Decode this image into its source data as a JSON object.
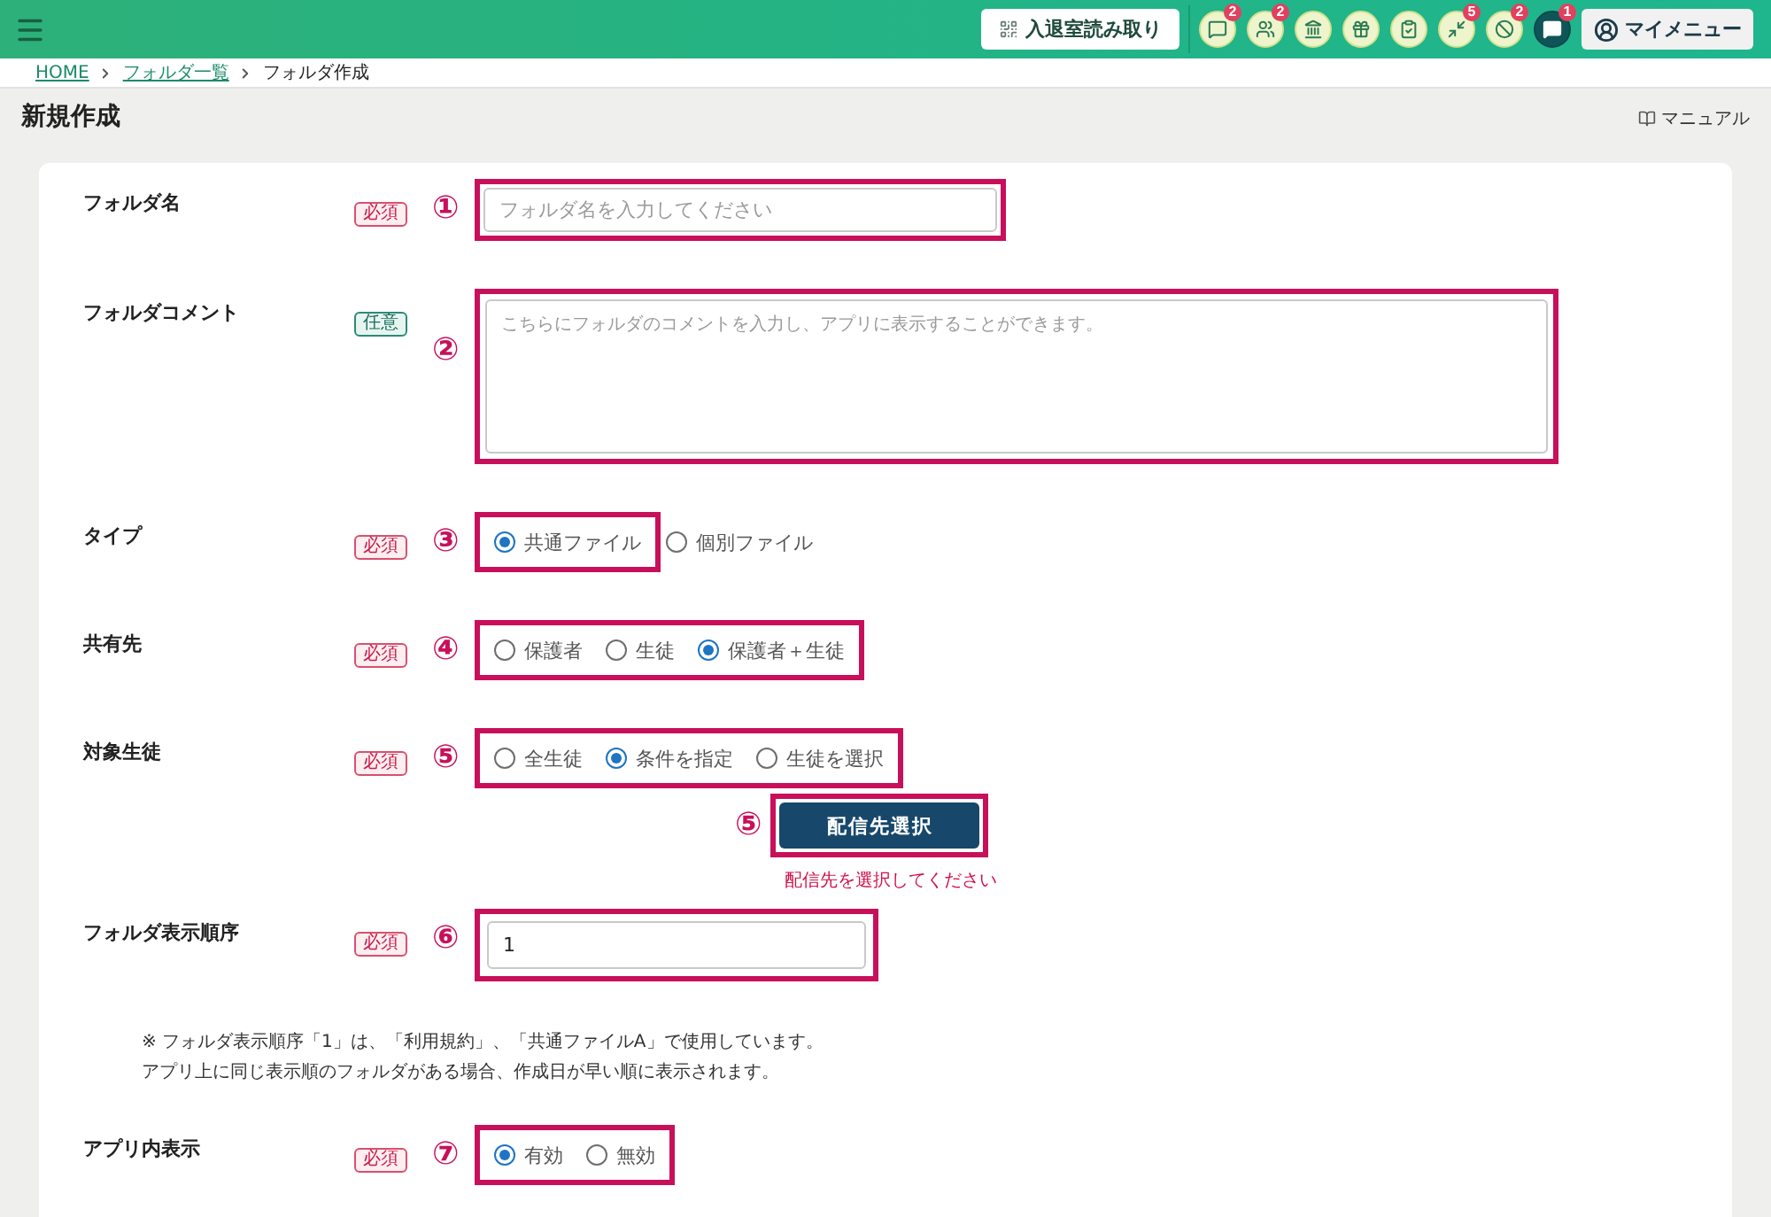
{
  "header": {
    "scan_button": "入退室読み取り",
    "icon_buttons": [
      {
        "badge": "2",
        "selected": false
      },
      {
        "badge": "2",
        "selected": false
      },
      {
        "selected": false
      },
      {
        "selected": false
      },
      {
        "selected": false
      },
      {
        "badge": "5",
        "selected": false
      },
      {
        "badge": "2",
        "selected": false
      },
      {
        "badge": "1",
        "selected": true
      }
    ],
    "menu_button": "マイメニュー"
  },
  "breadcrumb": [
    {
      "label": "HOME",
      "link": true
    },
    {
      "label": "フォルダ一覧",
      "link": true
    },
    {
      "label": "フォルダ作成",
      "link": false
    }
  ],
  "page": {
    "title": "新規作成",
    "manual_link": "マニュアル"
  },
  "form": {
    "fields": [
      {
        "kind": "text",
        "label": "フォルダ名",
        "badge": {
          "label": "必須",
          "required": true
        },
        "marker": "①",
        "placeholder": "フォルダ名を入力してください"
      },
      {
        "kind": "textarea",
        "label": "フォルダコメント",
        "badge": {
          "label": "任意",
          "required": false
        },
        "marker": "②",
        "placeholder": "こちらにフォルダのコメントを入力し、アプリに表示することができます。"
      },
      {
        "kind": "radio",
        "label": "タイプ",
        "badge": {
          "label": "必須",
          "required": true
        },
        "marker": "③",
        "options": [
          {
            "label": "共通ファイル",
            "selected": true
          }
        ],
        "options_outside_frame": [
          {
            "label": "個別ファイル",
            "selected": false
          }
        ]
      },
      {
        "kind": "radio",
        "label": "共有先",
        "badge": {
          "label": "必須",
          "required": true
        },
        "marker": "④",
        "options": [
          {
            "label": "保護者",
            "selected": false
          },
          {
            "label": "生徒",
            "selected": false
          },
          {
            "label": "保護者＋生徒",
            "selected": true
          }
        ]
      },
      {
        "kind": "radio",
        "label": "対象生徒",
        "badge": {
          "label": "必須",
          "required": true
        },
        "marker": "⑤",
        "options": [
          {
            "label": "全生徒",
            "selected": false
          },
          {
            "label": "条件を指定",
            "selected": true
          },
          {
            "label": "生徒を選択",
            "selected": false
          }
        ],
        "action": {
          "marker": "⑤",
          "button": "配信先選択",
          "error": "配信先を選択してください"
        }
      },
      {
        "kind": "number",
        "label": "フォルダ表示順序",
        "badge": {
          "label": "必須",
          "required": true
        },
        "marker": "⑥",
        "value": "1",
        "notes": [
          "※ フォルダ表示順序「1」は、「利用規約」、「共通ファイルA」で使用しています。",
          "アプリ上に同じ表示順のフォルダがある場合、作成日が早い順に表示されます。"
        ]
      },
      {
        "kind": "radio",
        "label": "アプリ内表示",
        "badge": {
          "label": "必須",
          "required": true
        },
        "marker": "⑦",
        "options": [
          {
            "label": "有効",
            "selected": true
          },
          {
            "label": "無効",
            "selected": false
          }
        ]
      }
    ]
  }
}
